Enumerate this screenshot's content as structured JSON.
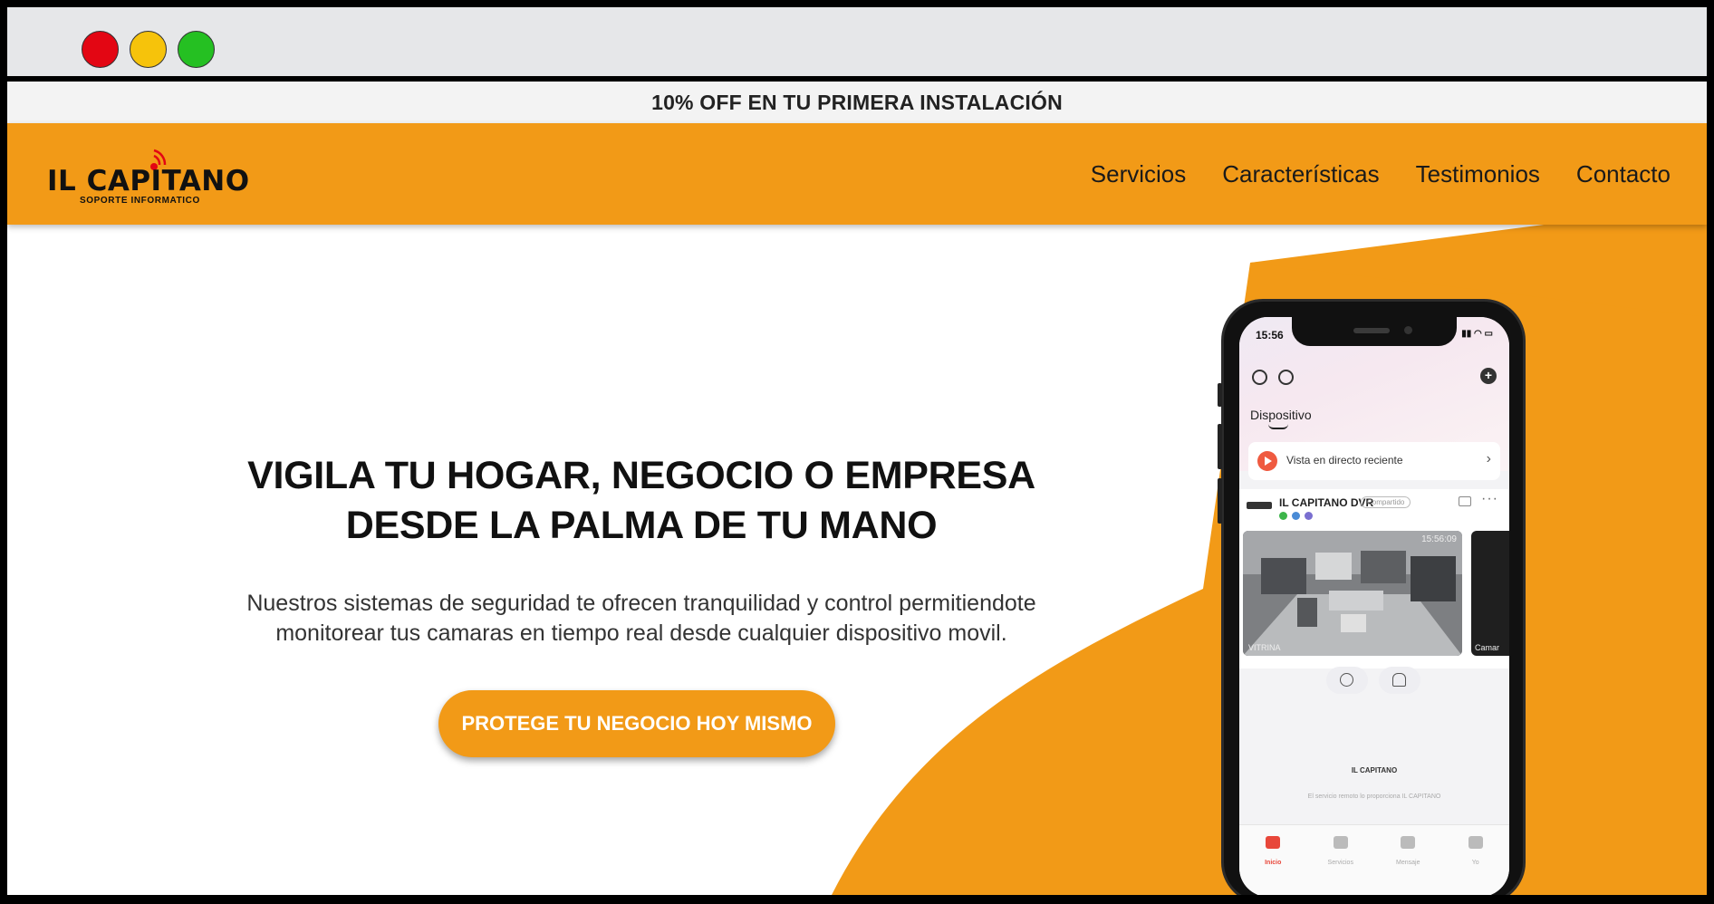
{
  "window": {
    "controls": [
      "close",
      "minimize",
      "maximize"
    ]
  },
  "promo": {
    "text": "10% OFF EN TU PRIMERA INSTALACIÓN"
  },
  "header": {
    "logo_main": "IL CAPITANO",
    "logo_sub": "SOPORTE INFORMATICO",
    "nav": [
      "Servicios",
      "Características",
      "Testimonios",
      "Contacto"
    ]
  },
  "hero": {
    "headline_line1": "VIGILA TU HOGAR, NEGOCIO O EMPRESA",
    "headline_line2": "DESDE LA PALMA DE TU MANO",
    "desc_line1": "Nuestros sistemas de seguridad te ofrecen tranquilidad y control permitiendote",
    "desc_line2": "monitorear tus camaras en tiempo real desde cualquier dispositivo movil.",
    "cta": "PROTEGE TU NEGOCIO HOY MISMO"
  },
  "phone": {
    "time": "15:56",
    "section_title": "Dispositivo",
    "recent_label": "Vista en directo reciente",
    "device_name": "IL CAPITANO DVR",
    "device_tag": "Compartido",
    "cam1_time": "15:56:09",
    "cam1_label": "VITRINA",
    "cam2_label": "Camar",
    "footer_logo": "IL CAPITANO",
    "footer_text": "El servicio remoto lo proporciona IL CAPITANO",
    "tabs": [
      "Inicio",
      "Servicios",
      "Mensaje",
      "Yo"
    ]
  },
  "colors": {
    "brand_orange": "#f29a17",
    "promo_bg": "#f3f3f3",
    "chrome_bg": "#e6e7e9"
  }
}
